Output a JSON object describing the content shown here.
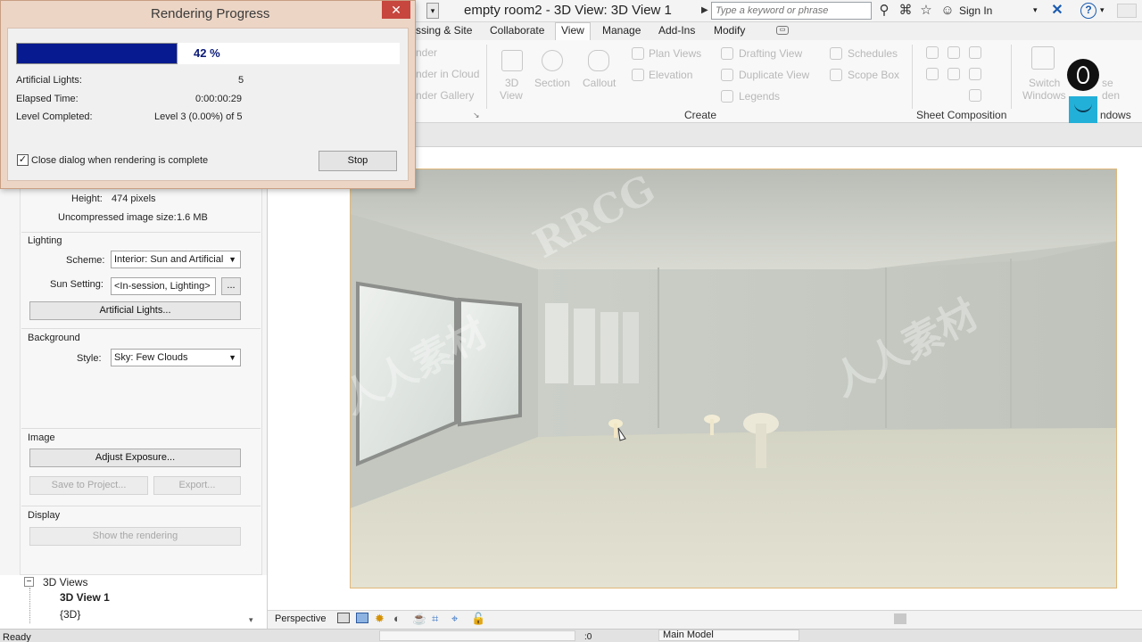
{
  "titlebar": {
    "title": "empty room2 - 3D View: 3D View 1",
    "search_placeholder": "Type a keyword or phrase",
    "sign_in": "Sign In",
    "icons": [
      "binoculars-icon",
      "connect-icon",
      "star-icon",
      "user-icon",
      "exchange-icon",
      "help-icon"
    ]
  },
  "ribbon": {
    "tabs": [
      "ssing & Site",
      "Collaborate",
      "View",
      "Manage",
      "Add-Ins",
      "Modify"
    ],
    "active_tab": "View",
    "left_partial": [
      "nder",
      "nder in Cloud",
      "nder Gallery"
    ],
    "create_tools": {
      "three_d": "3D",
      "view": "View",
      "section": "Section",
      "callout": "Callout",
      "plan_views": "Plan Views",
      "elevation": "Elevation",
      "drafting_view": "Drafting View",
      "duplicate_view": "Duplicate View",
      "legends": "Legends",
      "schedules": "Schedules",
      "scope_box": "Scope Box"
    },
    "panel_create": "Create",
    "panel_sheet_composition": "Sheet Composition",
    "switch": "Switch",
    "windows": "Windows",
    "close_partial": "se",
    "hidden_partial": "den",
    "windows_panel_partial": "ndows"
  },
  "rendering_progress": {
    "title": "Rendering Progress",
    "percent_label": "42 %",
    "percent": 0.42,
    "artificial_lights_label": "Artificial Lights:",
    "artificial_lights_value": "5",
    "elapsed_time_label": "Elapsed Time:",
    "elapsed_time_value": "0:00:00:29",
    "level_completed_label": "Level Completed:",
    "level_completed_value": "Level 3 (0.00%) of 5",
    "close_checkbox_label": "Close dialog when rendering is complete",
    "close_checkbox_checked": true,
    "stop_button": "Stop",
    "close_glyph": "✕"
  },
  "rendering_panel": {
    "height_label": "Height:",
    "height_value": "474 pixels",
    "uncompressed_label": "Uncompressed image size:",
    "uncompressed_value": "1.6 MB",
    "lighting_group": "Lighting",
    "scheme_label": "Scheme:",
    "scheme_value": "Interior: Sun and Artificial",
    "sun_setting_label": "Sun Setting:",
    "sun_setting_value": "<In-session, Lighting>",
    "sun_setting_browse": "...",
    "artificial_lights_button": "Artificial Lights...",
    "background_group": "Background",
    "style_label": "Style:",
    "style_value": "Sky: Few Clouds",
    "image_group": "Image",
    "adjust_exposure_button": "Adjust Exposure...",
    "save_to_project_button": "Save to Project...",
    "export_button": "Export...",
    "display_group": "Display",
    "show_rendering_button": "Show the rendering"
  },
  "project_browser": {
    "group": "3D Views",
    "items": [
      "3D View 1",
      "{3D}"
    ],
    "active_item": "3D View 1",
    "collapse_glyph": "−"
  },
  "view_control_bar": {
    "view_type": "Perspective"
  },
  "status_bar": {
    "status": "Ready",
    "coord": ":0",
    "model": "Main Model"
  },
  "watermarks": [
    "RRCG",
    "人人素材"
  ],
  "colors": {
    "progress_fill": "#071a8f",
    "dialog_frame": "#ecd5c5",
    "close_button": "#c7463d",
    "render_frame_border": "#e0b87a"
  }
}
